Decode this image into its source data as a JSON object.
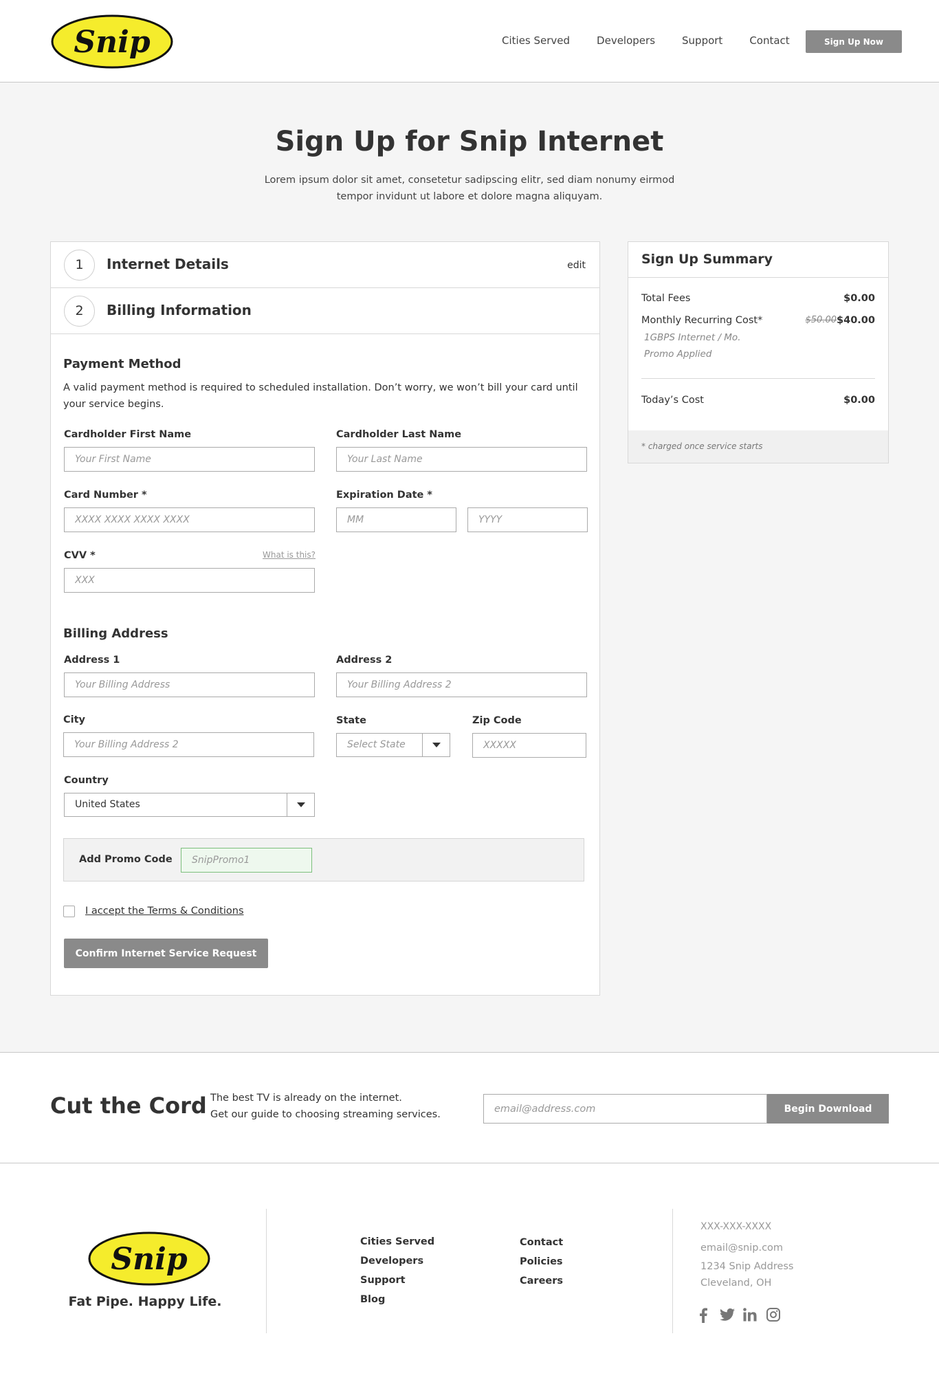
{
  "brand": {
    "logo_text": "Snip",
    "logo_color": "#f5ec2c"
  },
  "header": {
    "nav": [
      "Cities Served",
      "Developers",
      "Support",
      "Contact"
    ],
    "signup_label": "Sign Up Now"
  },
  "hero": {
    "title": "Sign Up for Snip Internet",
    "intro": "Lorem ipsum dolor sit amet, consetetur sadipscing elitr, sed diam nonumy eirmod tempor invidunt ut labore et dolore magna aliquyam."
  },
  "steps": [
    {
      "number": "1",
      "label": "Internet Details",
      "action": "edit"
    },
    {
      "number": "2",
      "label": "Billing Information"
    }
  ],
  "payment": {
    "title": "Payment Method",
    "description": "A valid payment method is required to scheduled installation. Don’t worry, we won’t bill your card until your service begins.",
    "first_name_label": "Cardholder First Name",
    "first_name_placeholder": "Your First Name",
    "last_name_label": "Cardholder Last Name",
    "last_name_placeholder": "Your Last Name",
    "card_label": "Card Number *",
    "card_placeholder": "XXXX XXXX XXXX XXXX",
    "exp_label": "Expiration Date *",
    "exp_month_placeholder": "MM",
    "exp_year_placeholder": "YYYY",
    "cvv_label": "CVV *",
    "cvv_help": "What is this?",
    "cvv_placeholder": "XXX"
  },
  "billing": {
    "title": "Billing Address",
    "address1_label": "Address 1",
    "address1_placeholder": "Your Billing Address",
    "address2_label": "Address 2",
    "address2_placeholder": "Your Billing Address 2",
    "city_label": "City",
    "city_placeholder": "Your Billing Address 2",
    "state_label": "State",
    "state_value": "Select State",
    "zip_label": "Zip Code",
    "zip_placeholder": "XXXXX",
    "country_label": "Country",
    "country_value": "United States"
  },
  "promo": {
    "label": "Add Promo Code",
    "placeholder": "SnipPromo1"
  },
  "terms_label": "I accept the Terms & Conditions",
  "confirm_label": "Confirm Internet Service Request",
  "summary": {
    "title": "Sign Up Summary",
    "total_fees_label": "Total Fees",
    "total_fees_value": "$0.00",
    "monthly_label": "Monthly Recurring Cost*",
    "monthly_old": "$50.00",
    "monthly_value": "$40.00",
    "plan_line": "1GBPS Internet / Mo.",
    "promo_line": "Promo Applied",
    "today_label": "Today’s Cost",
    "today_value": "$0.00",
    "note": "* charged once service starts"
  },
  "cord": {
    "title": "Cut the Cord",
    "line1": "The best TV is already on the internet.",
    "line2": "Get our guide to choosing streaming services.",
    "email_placeholder": "email@address.com",
    "button_label": "Begin Download"
  },
  "footer": {
    "tagline": "Fat Pipe. Happy Life.",
    "links_col1": [
      "Cities Served",
      "Developers",
      "Support",
      "Blog"
    ],
    "links_col2": [
      "Contact",
      "Policies",
      "Careers"
    ],
    "phone": "XXX-XXX-XXXX",
    "email": "email@snip.com",
    "address1": "1234 Snip Address",
    "address2": "Cleveland, OH",
    "social": [
      "facebook-icon",
      "twitter-icon",
      "linkedin-icon",
      "instagram-icon"
    ]
  }
}
